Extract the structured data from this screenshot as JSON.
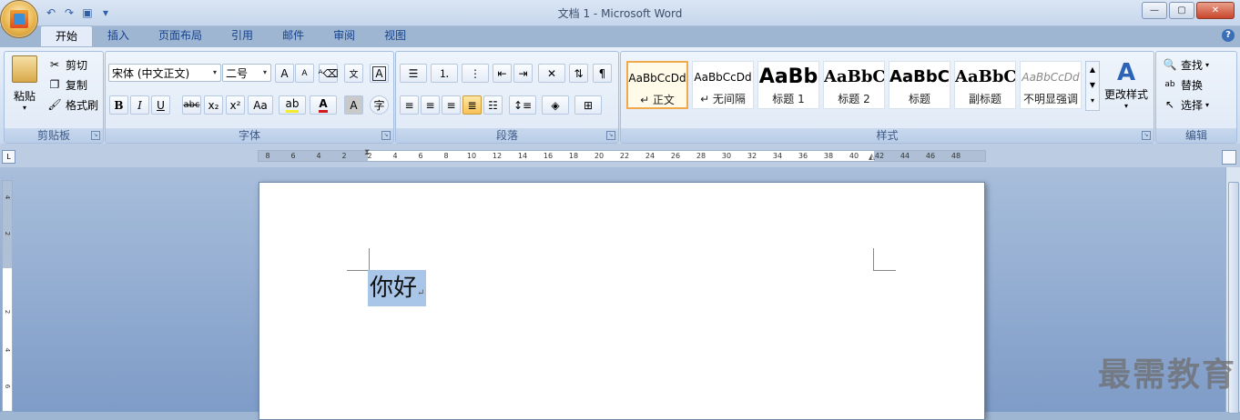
{
  "window": {
    "title": "文档 1 - Microsoft Word"
  },
  "qat": {
    "icons": [
      "undo-icon",
      "redo-icon",
      "save-icon",
      "customize-icon"
    ]
  },
  "tabs": [
    "开始",
    "插入",
    "页面布局",
    "引用",
    "邮件",
    "审阅",
    "视图"
  ],
  "clipboard": {
    "paste": "粘贴",
    "cut": "剪切",
    "copy": "复制",
    "format_painter": "格式刷",
    "label": "剪贴板"
  },
  "font": {
    "name": "宋体 (中文正文)",
    "size": "二号",
    "label": "字体",
    "bold": "B",
    "italic": "I",
    "underline": "U",
    "strike": "abc",
    "sub": "x₂",
    "sup": "x²",
    "case": "Aa",
    "grow": "A",
    "shrink": "A",
    "clear": "A"
  },
  "paragraph": {
    "label": "段落"
  },
  "styles": {
    "label": "样式",
    "change": "更改样式",
    "items": [
      {
        "preview": "AaBbCcDd",
        "name": "↵ 正文"
      },
      {
        "preview": "AaBbCcDd",
        "name": "↵ 无间隔"
      },
      {
        "preview": "AaBb",
        "name": "标题 1"
      },
      {
        "preview": "AaBbC",
        "name": "标题 2"
      },
      {
        "preview": "AaBbC",
        "name": "标题"
      },
      {
        "preview": "AaBbC",
        "name": "副标题"
      },
      {
        "preview": "AaBbCcDd",
        "name": "不明显强调"
      }
    ]
  },
  "editing": {
    "find": "查找",
    "replace": "替换",
    "select": "选择",
    "label": "编辑"
  },
  "ruler": {
    "ticks": [
      "8",
      "6",
      "4",
      "2",
      "2",
      "4",
      "6",
      "8",
      "10",
      "12",
      "14",
      "16",
      "18",
      "20",
      "22",
      "24",
      "26",
      "28",
      "30",
      "32",
      "34",
      "36",
      "38",
      "40",
      "42",
      "44",
      "46",
      "48"
    ]
  },
  "vruler": {
    "ticks": [
      "4",
      "2",
      "2",
      "4",
      "6"
    ]
  },
  "document": {
    "text": "你好"
  },
  "watermark": {
    "text": "最需教育"
  },
  "colors": {
    "accent": "#15428b",
    "selection": "#a9c6e8"
  }
}
